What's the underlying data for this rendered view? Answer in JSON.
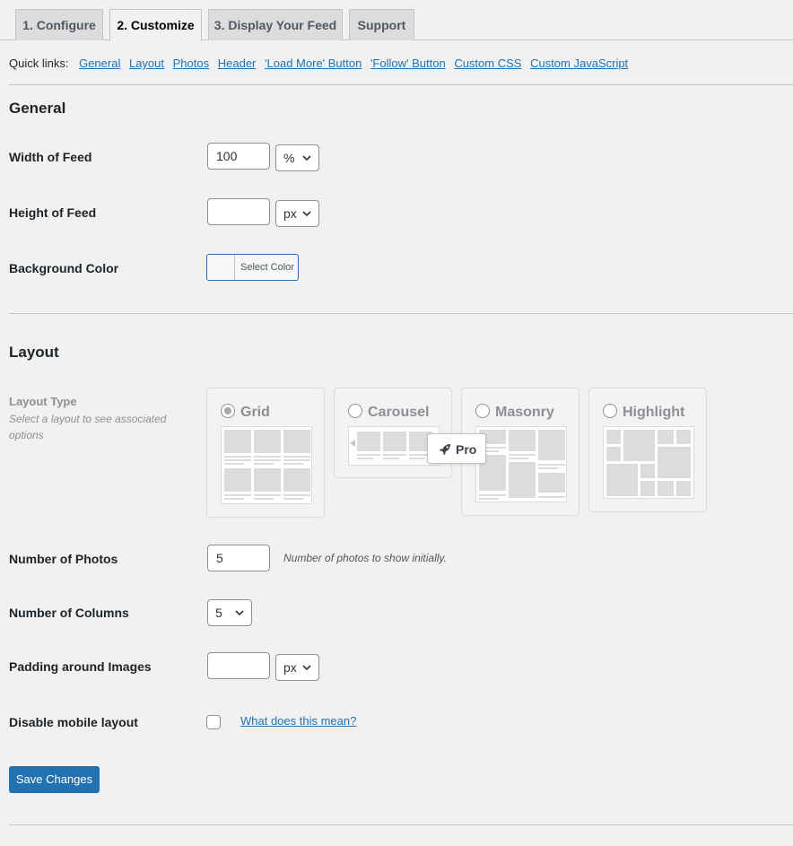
{
  "tabs": [
    {
      "label": "1. Configure"
    },
    {
      "label": "2. Customize"
    },
    {
      "label": "3. Display Your Feed"
    },
    {
      "label": "Support"
    }
  ],
  "quick_links": {
    "prefix": "Quick links:",
    "items": [
      "General",
      "Layout",
      "Photos",
      "Header",
      "'Load More' Button",
      "'Follow' Button",
      "Custom CSS",
      "Custom JavaScript"
    ]
  },
  "general": {
    "heading": "General",
    "width_label": "Width of Feed",
    "width_value": "100",
    "width_unit": "%",
    "height_label": "Height of Feed",
    "height_value": "",
    "height_unit": "px",
    "bg_label": "Background Color",
    "bg_button": "Select Color"
  },
  "layout": {
    "heading": "Layout",
    "type_label": "Layout Type",
    "type_desc": "Select a layout to see associated options",
    "options": [
      {
        "name": "Grid",
        "selected": true
      },
      {
        "name": "Carousel",
        "selected": false
      },
      {
        "name": "Masonry",
        "selected": false
      },
      {
        "name": "Highlight",
        "selected": false
      }
    ],
    "pro_badge": "Pro",
    "photos_label": "Number of Photos",
    "photos_value": "5",
    "photos_hint": "Number of photos to show initially.",
    "columns_label": "Number of Columns",
    "columns_value": "5",
    "padding_label": "Padding around Images",
    "padding_value": "",
    "padding_unit": "px",
    "mobile_label": "Disable mobile layout",
    "mobile_checked": false,
    "mobile_link": "What does this mean?"
  },
  "save_button": "Save Changes"
}
